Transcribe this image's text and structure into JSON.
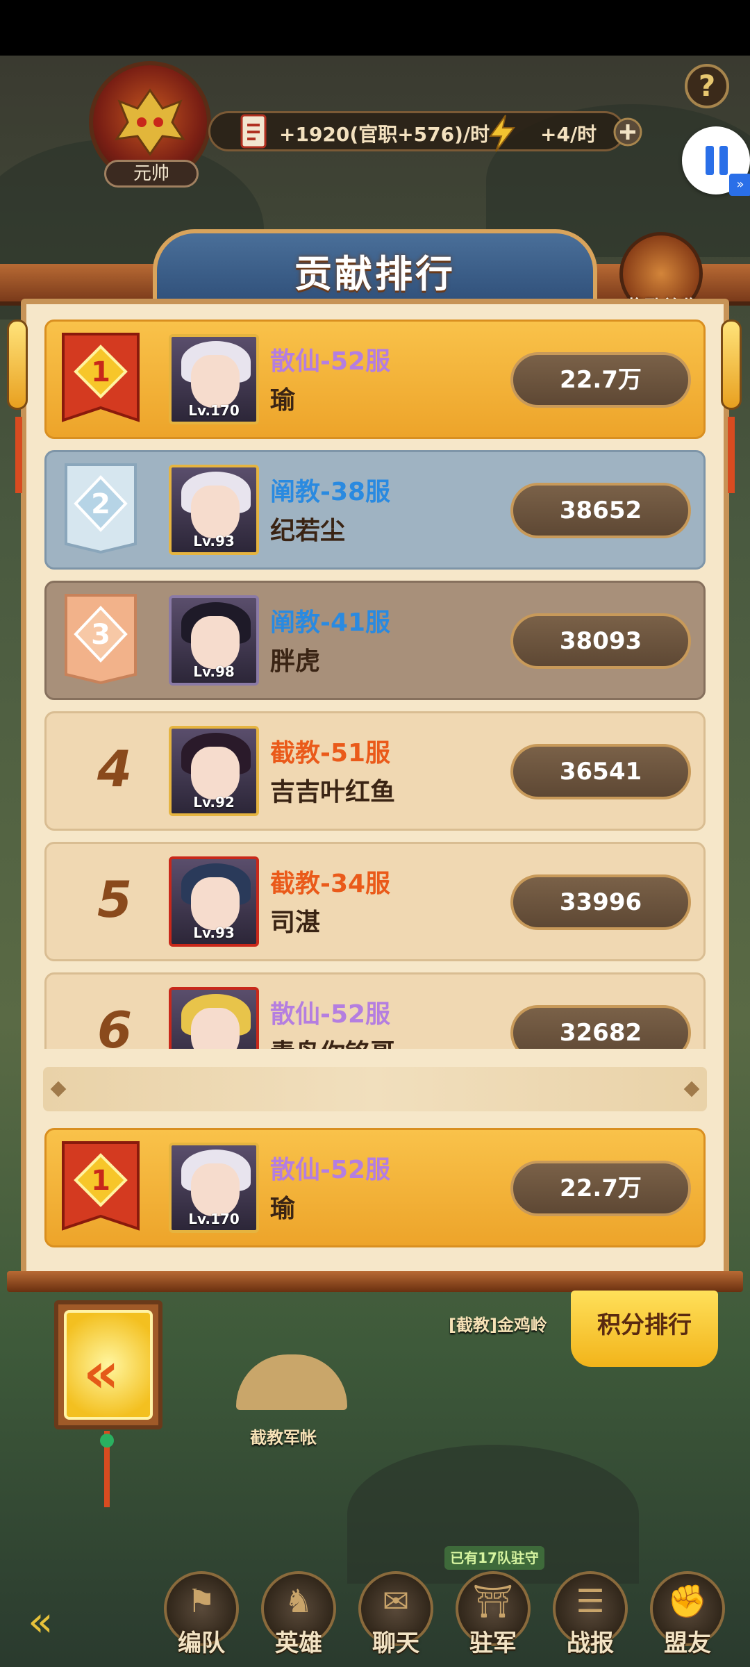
{
  "hud": {
    "rank_label": "元帅",
    "income": "+1920(官职+576)/时",
    "energy": "+4/时",
    "help": "?"
  },
  "panel": {
    "title": "贡献排行",
    "reward_label": "奖励总览"
  },
  "rows": [
    {
      "rank": "1",
      "level": "Lv.170",
      "server": "散仙-52服",
      "name": "瑜",
      "score": "22.7万"
    },
    {
      "rank": "2",
      "level": "Lv.93",
      "server": "阐教-38服",
      "name": "纪若尘",
      "score": "38652"
    },
    {
      "rank": "3",
      "level": "Lv.98",
      "server": "阐教-41服",
      "name": "胖虎",
      "score": "38093"
    },
    {
      "rank": "4",
      "level": "Lv.92",
      "server": "截教-51服",
      "name": "吉吉叶红鱼",
      "score": "36541"
    },
    {
      "rank": "5",
      "level": "Lv.93",
      "server": "截教-34服",
      "name": "司湛",
      "score": "33996"
    },
    {
      "rank": "6",
      "level": "",
      "server": "散仙-52服",
      "name": "青鸟你铭哥",
      "score": "32682"
    }
  ],
  "my_row": {
    "rank": "1",
    "level": "Lv.170",
    "server": "散仙-52服",
    "name": "瑜",
    "score": "22.7万"
  },
  "score_rank_button": "积分排行",
  "map_labels": {
    "location": "[截教]金鸡岭",
    "camp": "截教军帐"
  },
  "nav": {
    "badge": "已有17队驻守",
    "items": [
      "编队",
      "英雄",
      "聊天",
      "驻军",
      "战报",
      "盟友"
    ]
  },
  "colors": {
    "gold_row": "#eda42a",
    "silver_row": "#9fb3c2",
    "bronze_row": "#a8907a",
    "plain_row": "#f0d8b2",
    "sanxian": "#b47ee0",
    "chanjiao": "#2a8ae0",
    "jiejiao": "#ea5a1a"
  }
}
